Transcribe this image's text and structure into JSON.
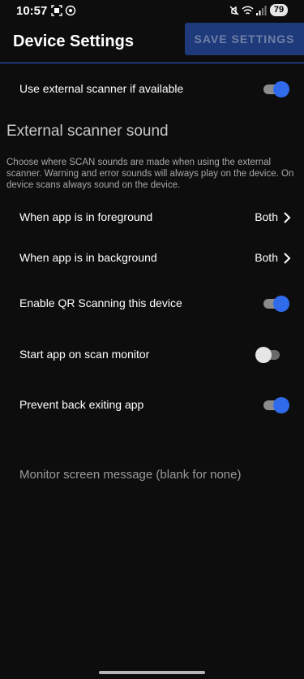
{
  "status_bar": {
    "time": "10:57",
    "battery": "79",
    "icons_left": [
      "screenshot-icon",
      "hotspot-icon"
    ],
    "icons_right": [
      "mute-icon",
      "wifi-icon",
      "signal-icon"
    ]
  },
  "header": {
    "title": "Device Settings",
    "save_label": "SAVE SETTINGS"
  },
  "settings": {
    "external_scanner": {
      "label": "Use external scanner if available",
      "checked": true
    },
    "section_title": "External scanner sound",
    "section_desc": "Choose where SCAN sounds are made when using the external scanner. Warning and error sounds will always play on the device. On device scans always sound on the device.",
    "foreground": {
      "label": "When app is in foreground",
      "value": "Both"
    },
    "background": {
      "label": "When app is in background",
      "value": "Both"
    },
    "qr_scanning": {
      "label": "Enable QR Scanning this device",
      "checked": true
    },
    "scan_monitor": {
      "label": "Start app on scan monitor",
      "checked": false
    },
    "prevent_back": {
      "label": "Prevent back exiting app",
      "checked": true
    },
    "monitor_message": {
      "placeholder": "Monitor screen message (blank for none)"
    }
  },
  "colors": {
    "accent": "#2f6bea",
    "button_bg": "#1e3a7a",
    "background": "#0d0d0d"
  }
}
